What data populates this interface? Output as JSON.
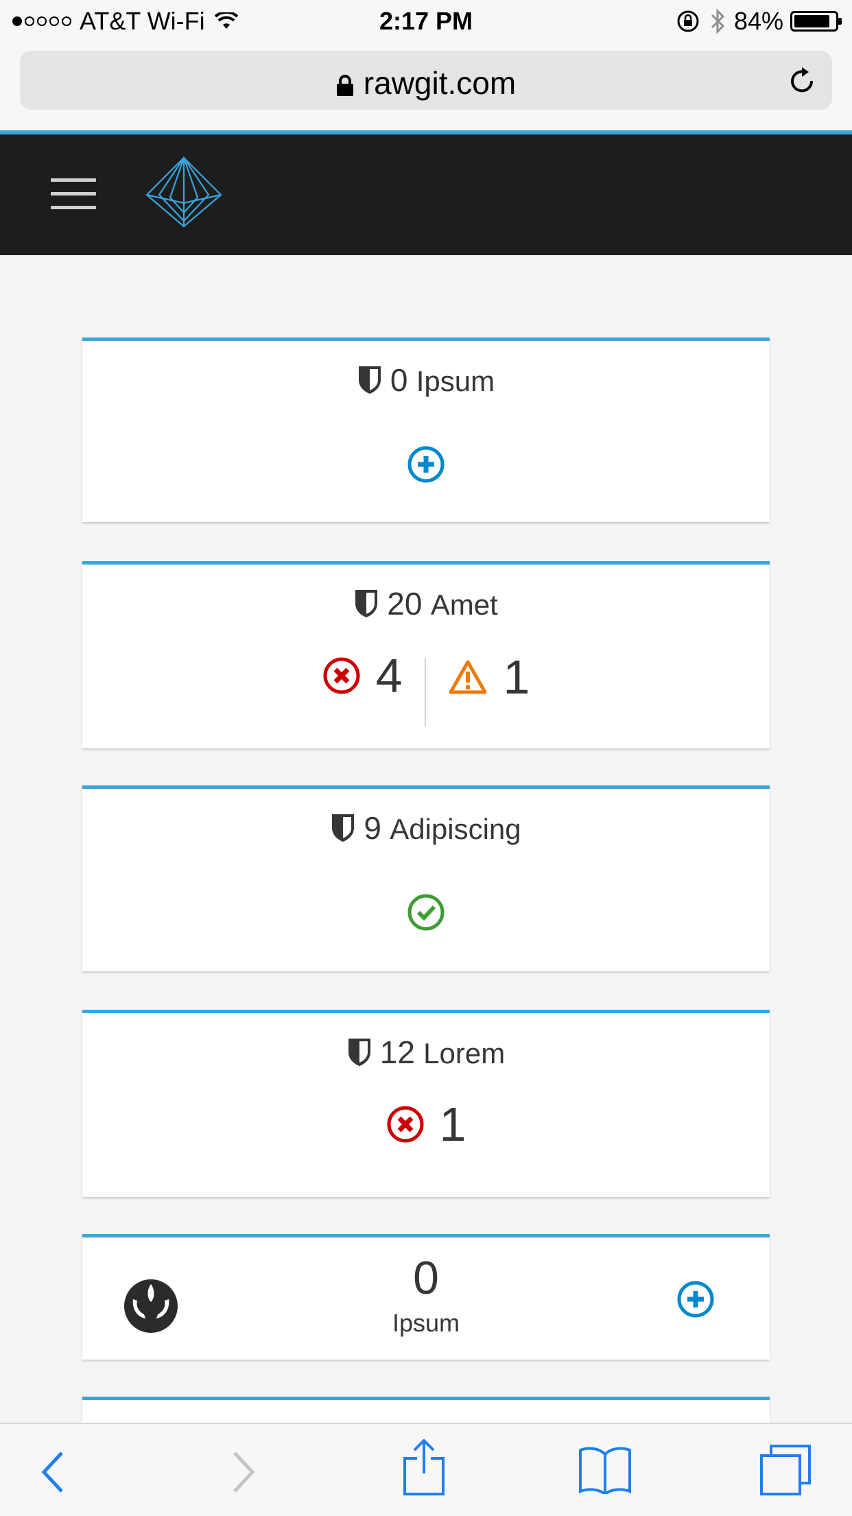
{
  "status_bar": {
    "carrier": "AT&T Wi-Fi",
    "time": "2:17 PM",
    "battery": "84%"
  },
  "browser": {
    "url": "rawgit.com"
  },
  "colors": {
    "accent": "#39a5dc",
    "masthead": "#1d1d1d",
    "error": "#cc0000",
    "warning": "#ec7a08",
    "ok": "#3f9c35",
    "add": "#0088ce"
  },
  "cards": [
    {
      "count": "0",
      "name": "Ipsum"
    },
    {
      "count": "20",
      "name": "Amet",
      "errors": "4",
      "warnings": "1"
    },
    {
      "count": "9",
      "name": "Adipiscing"
    },
    {
      "count": "12",
      "name": "Lorem",
      "errors": "1"
    }
  ],
  "split_card": {
    "count": "0",
    "label": "Ipsum"
  },
  "toolbar": {
    "icons": [
      "back-icon",
      "forward-icon",
      "share-icon",
      "bookmarks-icon",
      "tabs-icon"
    ]
  }
}
